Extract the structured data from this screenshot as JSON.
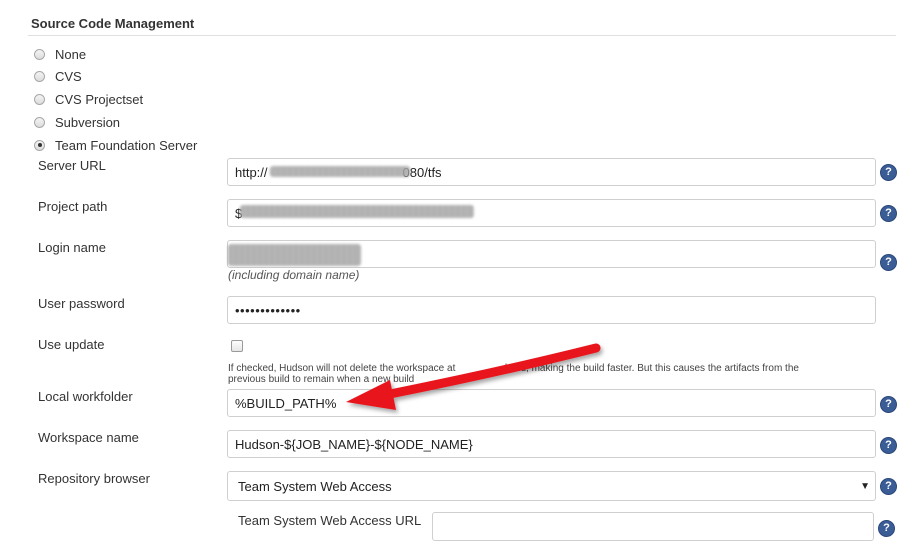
{
  "section": {
    "title": "Source Code Management"
  },
  "scm_options": [
    {
      "label": "None",
      "checked": false
    },
    {
      "label": "CVS",
      "checked": false
    },
    {
      "label": "CVS Projectset",
      "checked": false
    },
    {
      "label": "Subversion",
      "checked": false
    },
    {
      "label": "Team Foundation Server",
      "checked": true
    }
  ],
  "fields": {
    "server_url": {
      "label": "Server URL",
      "value_prefix": "http://",
      "value_suffix": "080/tfs"
    },
    "project_path": {
      "label": "Project path",
      "value_prefix": "$"
    },
    "login_name": {
      "label": "Login name",
      "hint": "(including domain name)"
    },
    "user_password": {
      "label": "User password",
      "value": "•••••••••••••"
    },
    "use_update": {
      "label": "Use update",
      "checked": false,
      "help_line1": "If checked, Hudson will not delete the workspace at",
      "help_line1_end": "build, making the build faster. But this causes the artifacts from the",
      "help_line2": "previous build to remain when a new build"
    },
    "local_workfolder": {
      "label": "Local workfolder",
      "value": "%BUILD_PATH%"
    },
    "workspace_name": {
      "label": "Workspace name",
      "value": "Hudson-${JOB_NAME}-${NODE_NAME}"
    },
    "repository_browser": {
      "label": "Repository browser",
      "selected": "Team System Web Access",
      "sub_label": "Team System Web Access URL",
      "sub_value": ""
    }
  },
  "help_icon_glyph": "?",
  "dropdown_glyph": "▼",
  "colors": {
    "arrow": "#e8141c",
    "help_icon": "#3b5d95"
  }
}
